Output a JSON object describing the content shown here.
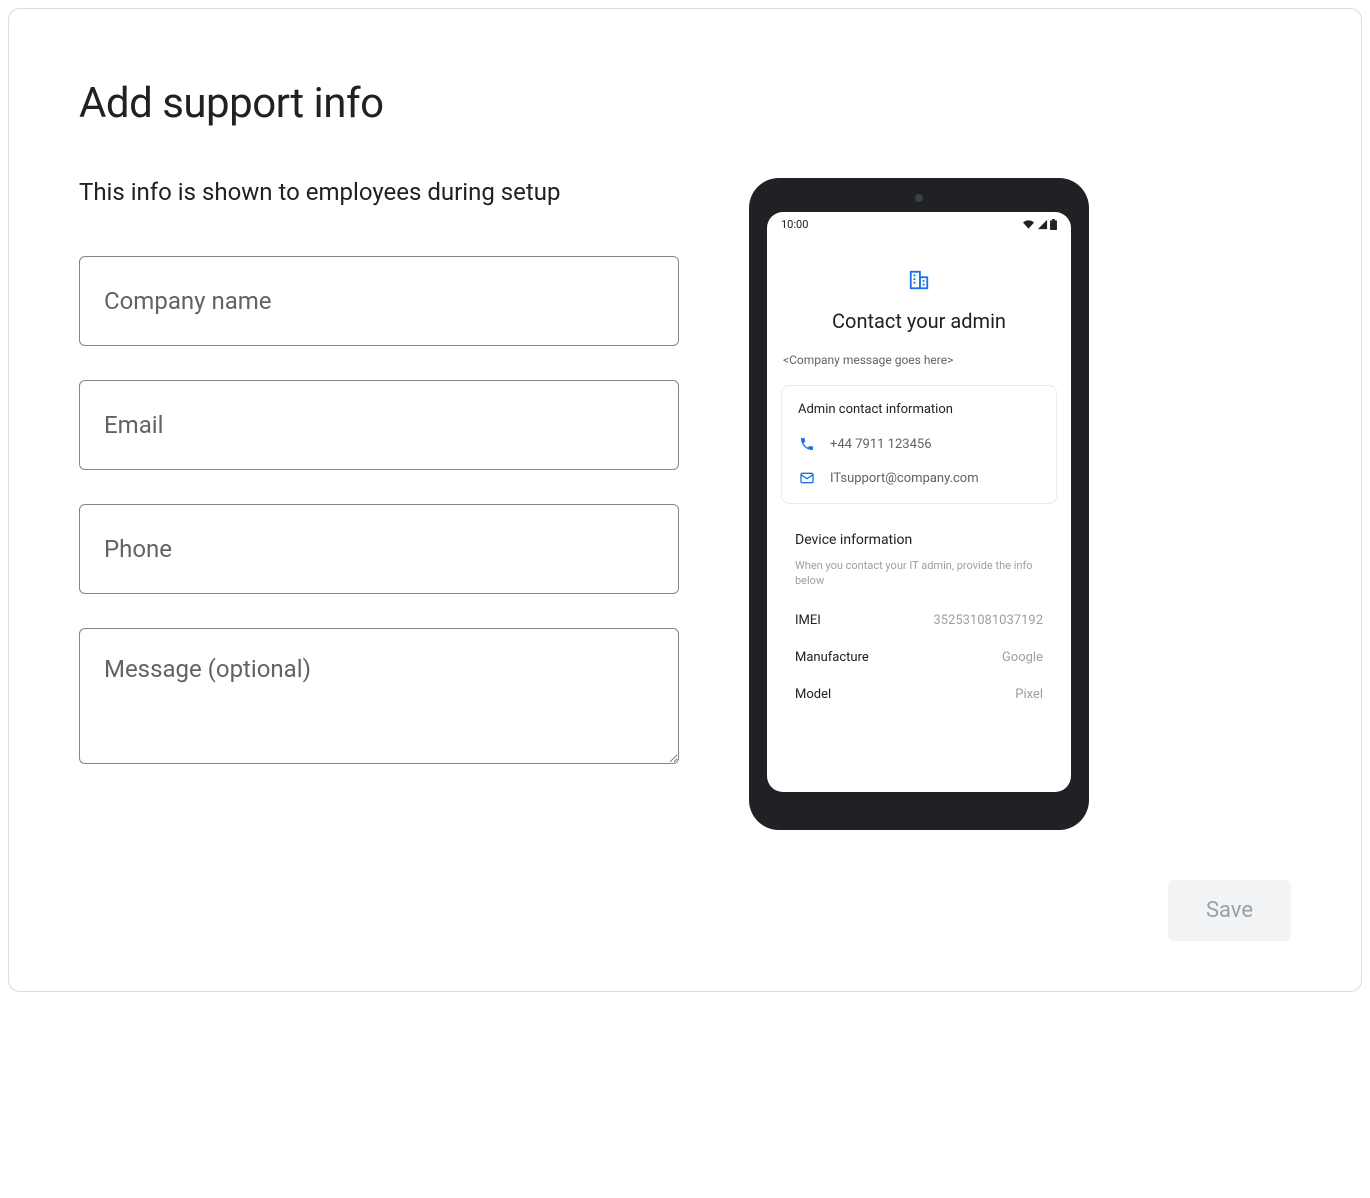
{
  "header": {
    "title": "Add support info",
    "subtitle": "This info is shown to employees during setup"
  },
  "form": {
    "company_placeholder": "Company name",
    "email_placeholder": "Email",
    "phone_placeholder": "Phone",
    "message_placeholder": "Message (optional)"
  },
  "preview": {
    "status_time": "10:00",
    "heading": "Contact your admin",
    "message_placeholder": "<Company message goes here>",
    "contact_card": {
      "title": "Admin contact information",
      "phone": "+44 7911 123456",
      "email": "ITsupport@company.com"
    },
    "device": {
      "title": "Device information",
      "hint": "When you contact your IT admin, provide the info below",
      "rows": [
        {
          "label": "IMEI",
          "value": "352531081037192"
        },
        {
          "label": "Manufacture",
          "value": "Google"
        },
        {
          "label": "Model",
          "value": "Pixel"
        }
      ]
    }
  },
  "actions": {
    "save_label": "Save"
  }
}
